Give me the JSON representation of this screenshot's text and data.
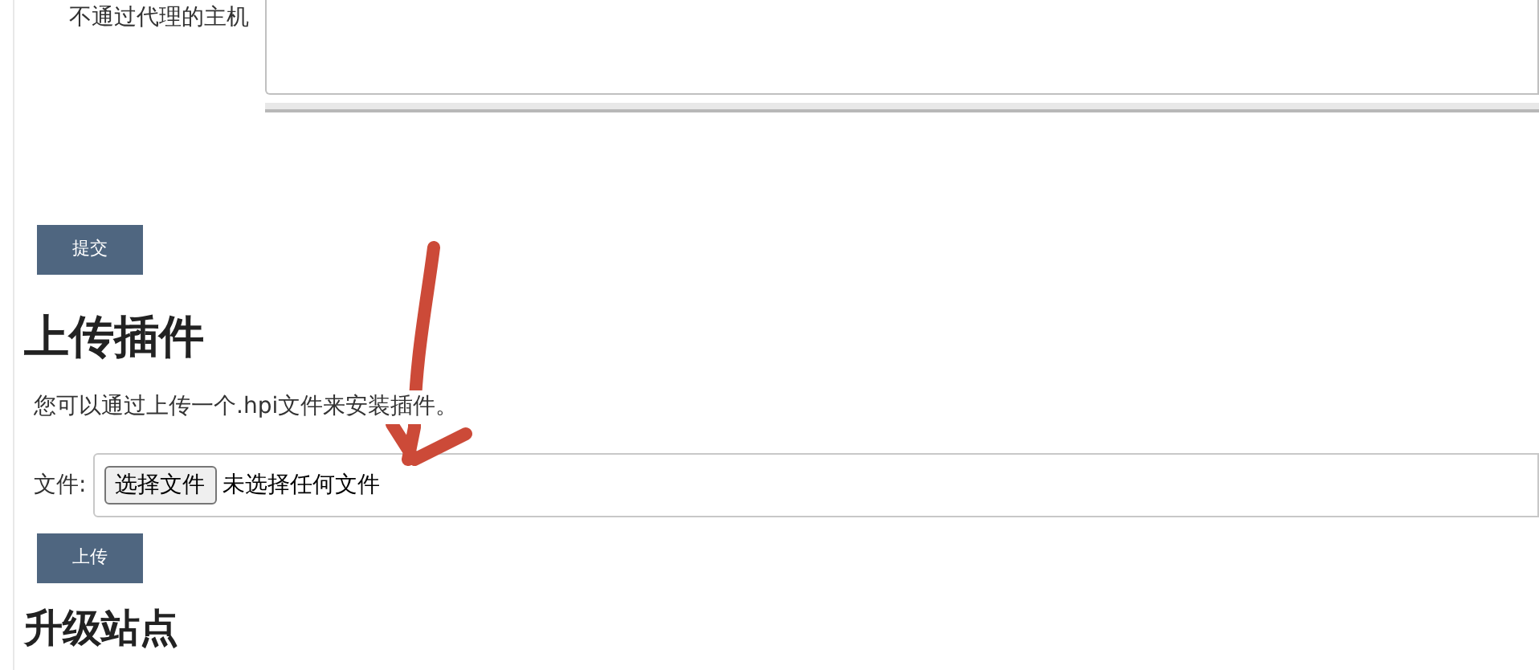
{
  "proxy_form": {
    "no_proxy_label": "不通过代理的主机",
    "submit_button": "提交"
  },
  "upload_plugin": {
    "heading": "上传插件",
    "description": "您可以通过上传一个.hpi文件来安装插件。",
    "file_label": "文件:",
    "choose_button": "选择文件",
    "file_status": "未选择任何文件",
    "upload_button": "上传"
  },
  "next_section": {
    "heading": "升级站点"
  }
}
